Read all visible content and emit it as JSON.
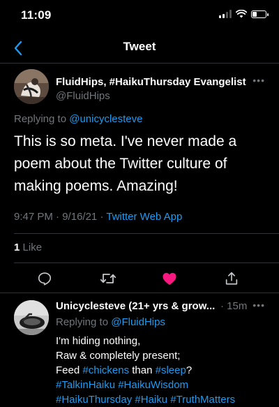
{
  "status_bar": {
    "time": "11:09",
    "battery_level": 0.35
  },
  "nav": {
    "title": "Tweet",
    "back_icon": "chevron-left-icon"
  },
  "main_tweet": {
    "author_name": "FluidHips, #HaikuThursday Evangelist",
    "author_handle": "@FluidHips",
    "replying_prefix": "Replying to",
    "replying_to": "@unicyclesteve",
    "text": "This is so meta. I've never made a poem about the Twitter culture of making poems. Amazing!",
    "time": "9:47 PM",
    "date": "9/16/21",
    "separator": "·",
    "source": "Twitter Web App",
    "likes_count": "1",
    "likes_label": "Like",
    "liked": true,
    "action_icons": [
      "reply-icon",
      "retweet-icon",
      "like-icon",
      "share-icon"
    ]
  },
  "reply_tweet": {
    "author_name": "Unicyclesteve (21+ yrs & grow...",
    "time": "· 15m",
    "replying_prefix": "Replying to",
    "replying_to": "@FluidHips",
    "line1": "I'm hiding nothing,",
    "line2": "Raw & completely present;",
    "line3_a": "Feed",
    "tag_chickens": "#chickens",
    "line3_b": "than",
    "tag_sleep": "#sleep",
    "line3_c": "?",
    "tag_talkinhaiku": "#TalkinHaiku",
    "tag_haikuwisdom": "#HaikuWisdom",
    "tag_haikuthursday": "#HaikuThursday",
    "tag_haiku": "#Haiku",
    "tag_truthmatters": "#TruthMatters"
  },
  "colors": {
    "background": "#000000",
    "accent": "#1d9bf0",
    "secondary_text": "#71767b",
    "like": "#f91880",
    "divider": "#2f3336"
  }
}
